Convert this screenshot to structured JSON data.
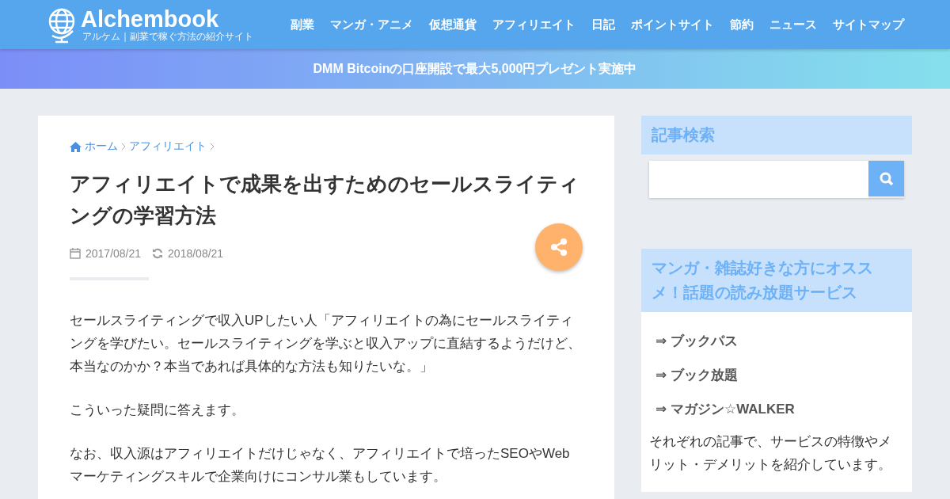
{
  "header": {
    "logo": "Alchembook",
    "tagline": "アルケム｜副業で稼ぐ方法の紹介サイト",
    "nav": [
      "副業",
      "マンガ・アニメ",
      "仮想通貨",
      "アフィリエイト",
      "日記",
      "ポイントサイト",
      "節約",
      "ニュース",
      "サイトマップ"
    ]
  },
  "banner": "DMM Bitcoinの口座開設で最大5,000円プレゼント実施中",
  "article": {
    "breadcrumbs": [
      "ホーム",
      "アフィリエイト"
    ],
    "title": "アフィリエイトで成果を出すためのセールスライティングの学習方法",
    "published": "2017/08/21",
    "updated": "2018/08/21",
    "paragraphs": [
      "セールスライティングで収入UPしたい人「アフィリエイトの為にセールスライティングを学びたい。セールスライティングを学ぶと収入アップに直結するようだけど、本当なのかか？本当であれば具体的な方法も知りたいな。」",
      "こういった疑問に答えます。",
      "なお、収入源はアフィリエイトだけじゃなく、アフィリエイトで培ったSEOやWebマーケティングスキルで企業向けにコンサル業もしています。"
    ]
  },
  "sidebar": {
    "search": {
      "title": "記事検索"
    },
    "recommend": {
      "title": "マンガ・雑誌好きな方にオススメ！話題の読み放題サービス",
      "links": [
        "⇒ ブックパス",
        "⇒ ブック放題",
        "⇒ マガジン☆WALKER"
      ],
      "note": "それぞれの記事で、サービスの特徴やメリット・デメリットを紹介しています。"
    }
  }
}
